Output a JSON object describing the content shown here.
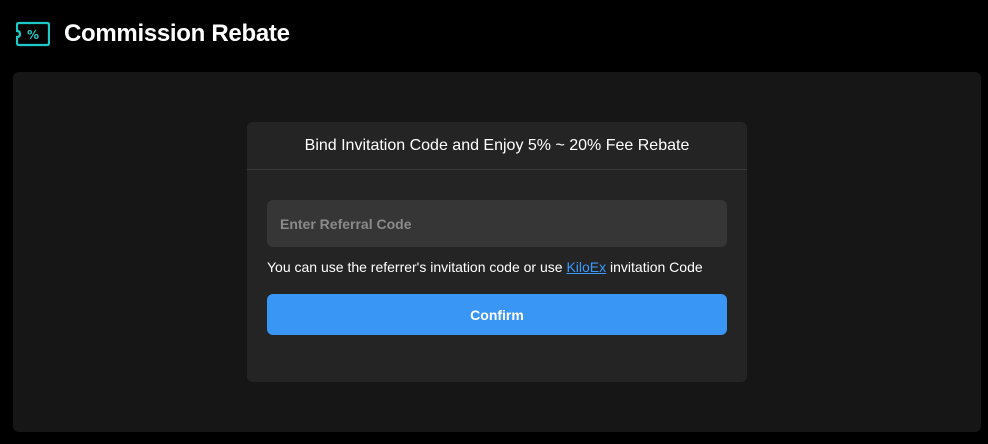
{
  "header": {
    "title": "Commission Rebate",
    "icon": "percent-ticket-icon",
    "icon_color": "#1ec8c8",
    "icon_glyph": "%"
  },
  "card": {
    "title": "Bind Invitation Code and Enjoy 5% ~ 20% Fee Rebate",
    "input": {
      "placeholder": "Enter Referral Code",
      "value": ""
    },
    "hint": {
      "prefix": "You can use the referrer's invitation code or use ",
      "link_text": "KiloEx",
      "suffix": " invitation Code",
      "link_color": "#3a99ff"
    },
    "confirm_label": "Confirm",
    "confirm_color": "#3996f5"
  }
}
